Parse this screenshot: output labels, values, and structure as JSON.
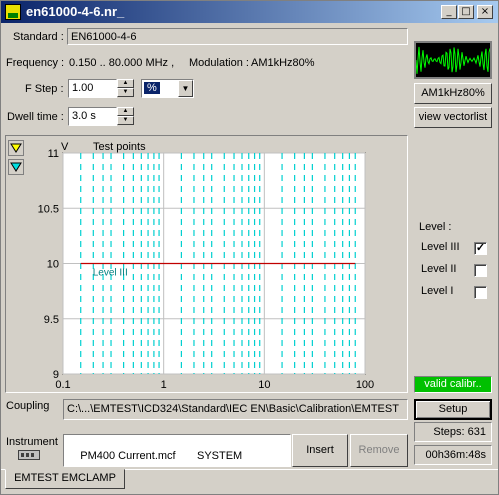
{
  "window": {
    "title": "en61000-4-6.nr_"
  },
  "standard": {
    "label": "Standard :",
    "value": "EN61000-4-6"
  },
  "frequency": {
    "label": "Frequency :",
    "value": "0.150 .. 80.000 MHz ,",
    "modulation_label": "Modulation :",
    "modulation_value": "AM1kHz80%"
  },
  "fstep": {
    "label": "F Step :",
    "value": "1.00",
    "unit": "%"
  },
  "dwell": {
    "label": "Dwell time :",
    "value": "3.0 s"
  },
  "side": {
    "modulation_button": "AM1kHz80%",
    "vectorlist_button": "view vectorlist"
  },
  "level": {
    "title": "Level :",
    "items": [
      {
        "label": "Level III",
        "checked": true
      },
      {
        "label": "Level II",
        "checked": false
      },
      {
        "label": "Level I",
        "checked": false
      }
    ]
  },
  "status": {
    "valid": "valid calibr..",
    "setup_button": "Setup",
    "steps": "Steps:  631",
    "time": "00h36m:48s"
  },
  "coupling": {
    "label": "Coupling",
    "path": "C:\\...\\EMTEST\\ICD324\\Standard\\IEC EN\\Basic\\Calibration\\EMTEST"
  },
  "instrument": {
    "label": "Instrument",
    "text": "PM400 Current.mcf       SYSTEM",
    "insert_button": "Insert",
    "remove_button": "Remove"
  },
  "tab": {
    "label": "EMTEST EMCLAMP"
  },
  "colors": {
    "series": "#c00000",
    "testpoints": "#00d0d0",
    "valid": "#00c000"
  },
  "chart_data": {
    "type": "line",
    "title": "Test points",
    "ylabel": "V",
    "xscale": "log",
    "xlim": [
      0.1,
      100
    ],
    "ylim": [
      9,
      11
    ],
    "yticks": [
      "9",
      "9.5",
      "10",
      "10.5",
      "11"
    ],
    "xticks": [
      "0.1",
      "1",
      "10",
      "100"
    ],
    "grid": true,
    "series": [
      {
        "name": "Level III",
        "x": [
          0.15,
          80
        ],
        "y": [
          10,
          10
        ]
      }
    ],
    "testpoints_mhz": [
      0.15,
      0.2,
      0.25,
      0.3,
      0.4,
      0.5,
      0.6,
      0.7,
      0.8,
      0.9,
      1.5,
      2,
      2.5,
      3,
      4,
      5,
      6,
      7,
      8,
      9,
      15,
      20,
      25,
      30,
      40,
      50,
      60,
      70,
      80
    ]
  }
}
